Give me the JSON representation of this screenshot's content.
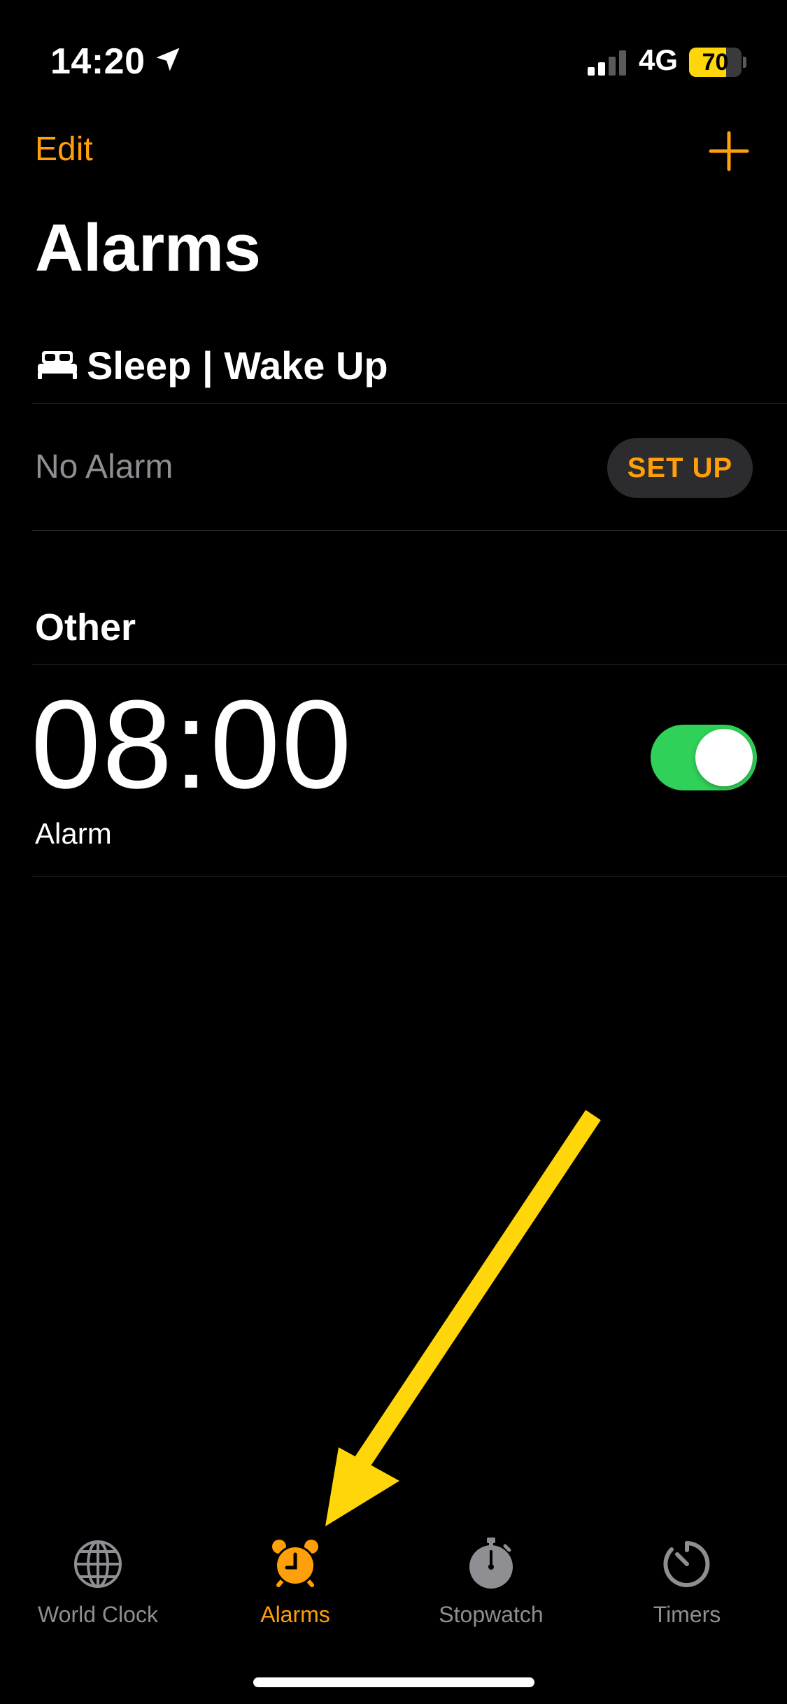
{
  "status_bar": {
    "time": "14:20",
    "network": "4G",
    "battery": "70",
    "battery_level": 0.7,
    "signal_bars_active": 2
  },
  "nav": {
    "edit_label": "Edit",
    "add_icon": "plus-icon",
    "title": "Alarms"
  },
  "sleep_section": {
    "icon": "bed-icon",
    "header": "Sleep | Wake Up",
    "no_alarm_label": "No Alarm",
    "setup_label": "SET UP"
  },
  "other_section": {
    "header": "Other",
    "alarms": [
      {
        "time": "08:00",
        "label": "Alarm",
        "enabled": true
      }
    ]
  },
  "tab_bar": {
    "tabs": [
      {
        "label": "World Clock",
        "icon": "globe-icon",
        "active": false
      },
      {
        "label": "Alarms",
        "icon": "alarm-clock-icon",
        "active": true
      },
      {
        "label": "Stopwatch",
        "icon": "stopwatch-icon",
        "active": false
      },
      {
        "label": "Timers",
        "icon": "timer-icon",
        "active": false
      }
    ]
  },
  "colors": {
    "accent": "#ff9f0a",
    "toggle_on": "#30d158",
    "annotation_arrow": "#ffd60a",
    "battery_fill": "#ffd60a"
  }
}
